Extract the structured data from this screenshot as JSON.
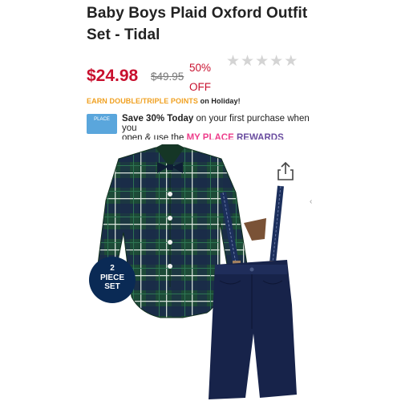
{
  "product": {
    "title": "Baby Boys Plaid Oxford Outfit Set - Tidal",
    "price": "$24.98",
    "original_price": "$49.95",
    "discount": "50% OFF",
    "rating_stars": 0,
    "rating_max": 5
  },
  "points": {
    "earn": "EARN DOUBLE/TRIPLE POINTS",
    "on": "on Holiday!"
  },
  "promo": {
    "logo_text": "PLACE",
    "bold": "Save 30% Today",
    "line1": " on your first purchase when you",
    "line2": "open & use the ",
    "rewards_1": "MY PLACE",
    "rewards_2": "REWARDS"
  },
  "badge": {
    "line1": "2",
    "line2": "PIECE",
    "line3": "SET"
  },
  "icons": {
    "share": "share-icon",
    "star": "star-icon"
  },
  "colors": {
    "price": "#c8102e",
    "points": "#f0a020",
    "badge": "#0a2a55"
  }
}
